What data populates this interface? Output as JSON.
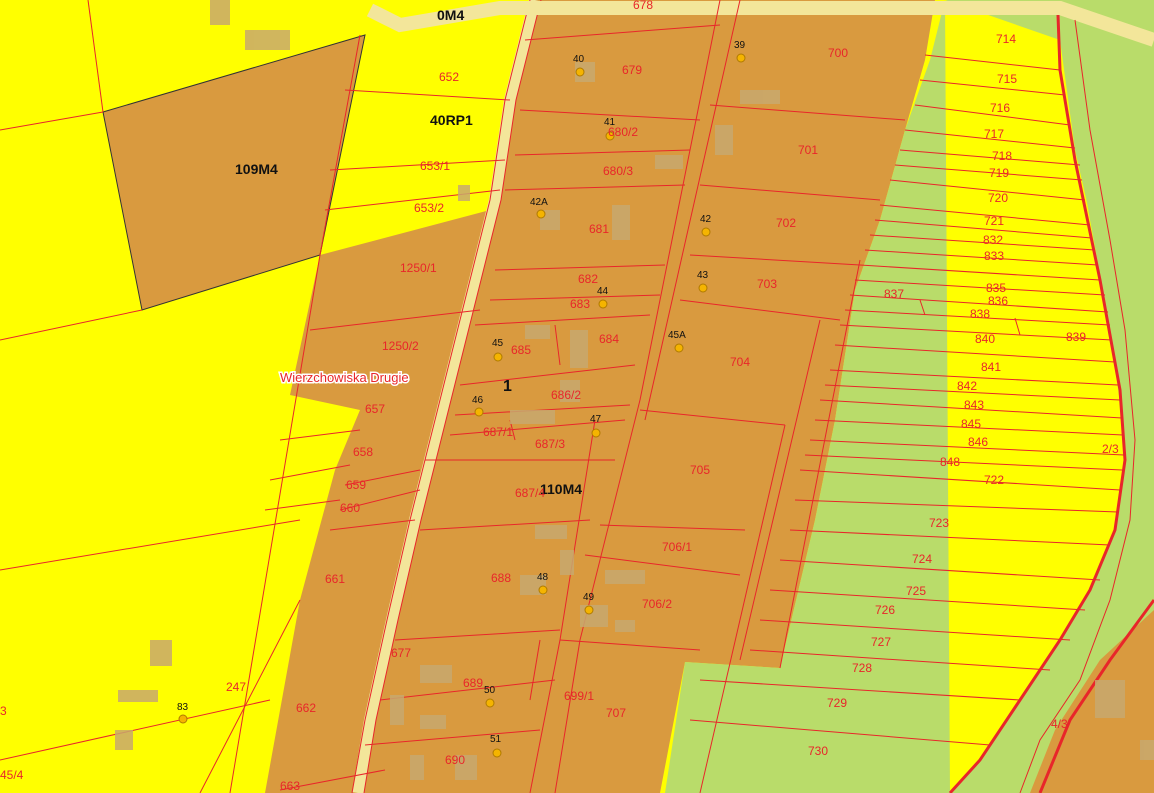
{
  "map": {
    "place_name": "Wierzchowiska Drugie",
    "road_number": "1",
    "colors": {
      "yellow_zone": "#ffff00",
      "brown_zone": "#d99a3f",
      "green_zone": "#b9dc6a",
      "road": "#f3e69a",
      "parcel_line": "#e8262a",
      "building": "#c8a96e"
    },
    "zones": [
      {
        "id": "z1",
        "label": "109M4"
      },
      {
        "id": "z2",
        "label": "40RP1"
      },
      {
        "id": "z3",
        "label": "110M4"
      },
      {
        "id": "z4",
        "label": "0M4"
      }
    ],
    "parcels": [
      "678",
      "679",
      "680/2",
      "680/3",
      "681",
      "682",
      "683",
      "684",
      "685",
      "686/2",
      "687/1",
      "687/3",
      "687/4",
      "688",
      "689",
      "690",
      "699/1",
      "700",
      "701",
      "702",
      "703",
      "704",
      "705",
      "706/1",
      "706/2",
      "707",
      "714",
      "715",
      "716",
      "717",
      "718",
      "719",
      "720",
      "721",
      "722",
      "723",
      "724",
      "725",
      "726",
      "727",
      "728",
      "729",
      "730",
      "832",
      "833",
      "835",
      "836",
      "837",
      "838",
      "839",
      "840",
      "841",
      "842",
      "843",
      "845",
      "846",
      "848",
      "652",
      "653/1",
      "653/2",
      "657",
      "658",
      "659",
      "660",
      "661",
      "662",
      "663",
      "677",
      "1250/1",
      "1250/2",
      "247",
      "2/3",
      "4/3",
      "45/4",
      "3"
    ],
    "addresses": [
      "39",
      "40",
      "41",
      "42",
      "42A",
      "43",
      "44",
      "45",
      "45A",
      "46",
      "47",
      "48",
      "49",
      "50",
      "51",
      "83"
    ]
  }
}
